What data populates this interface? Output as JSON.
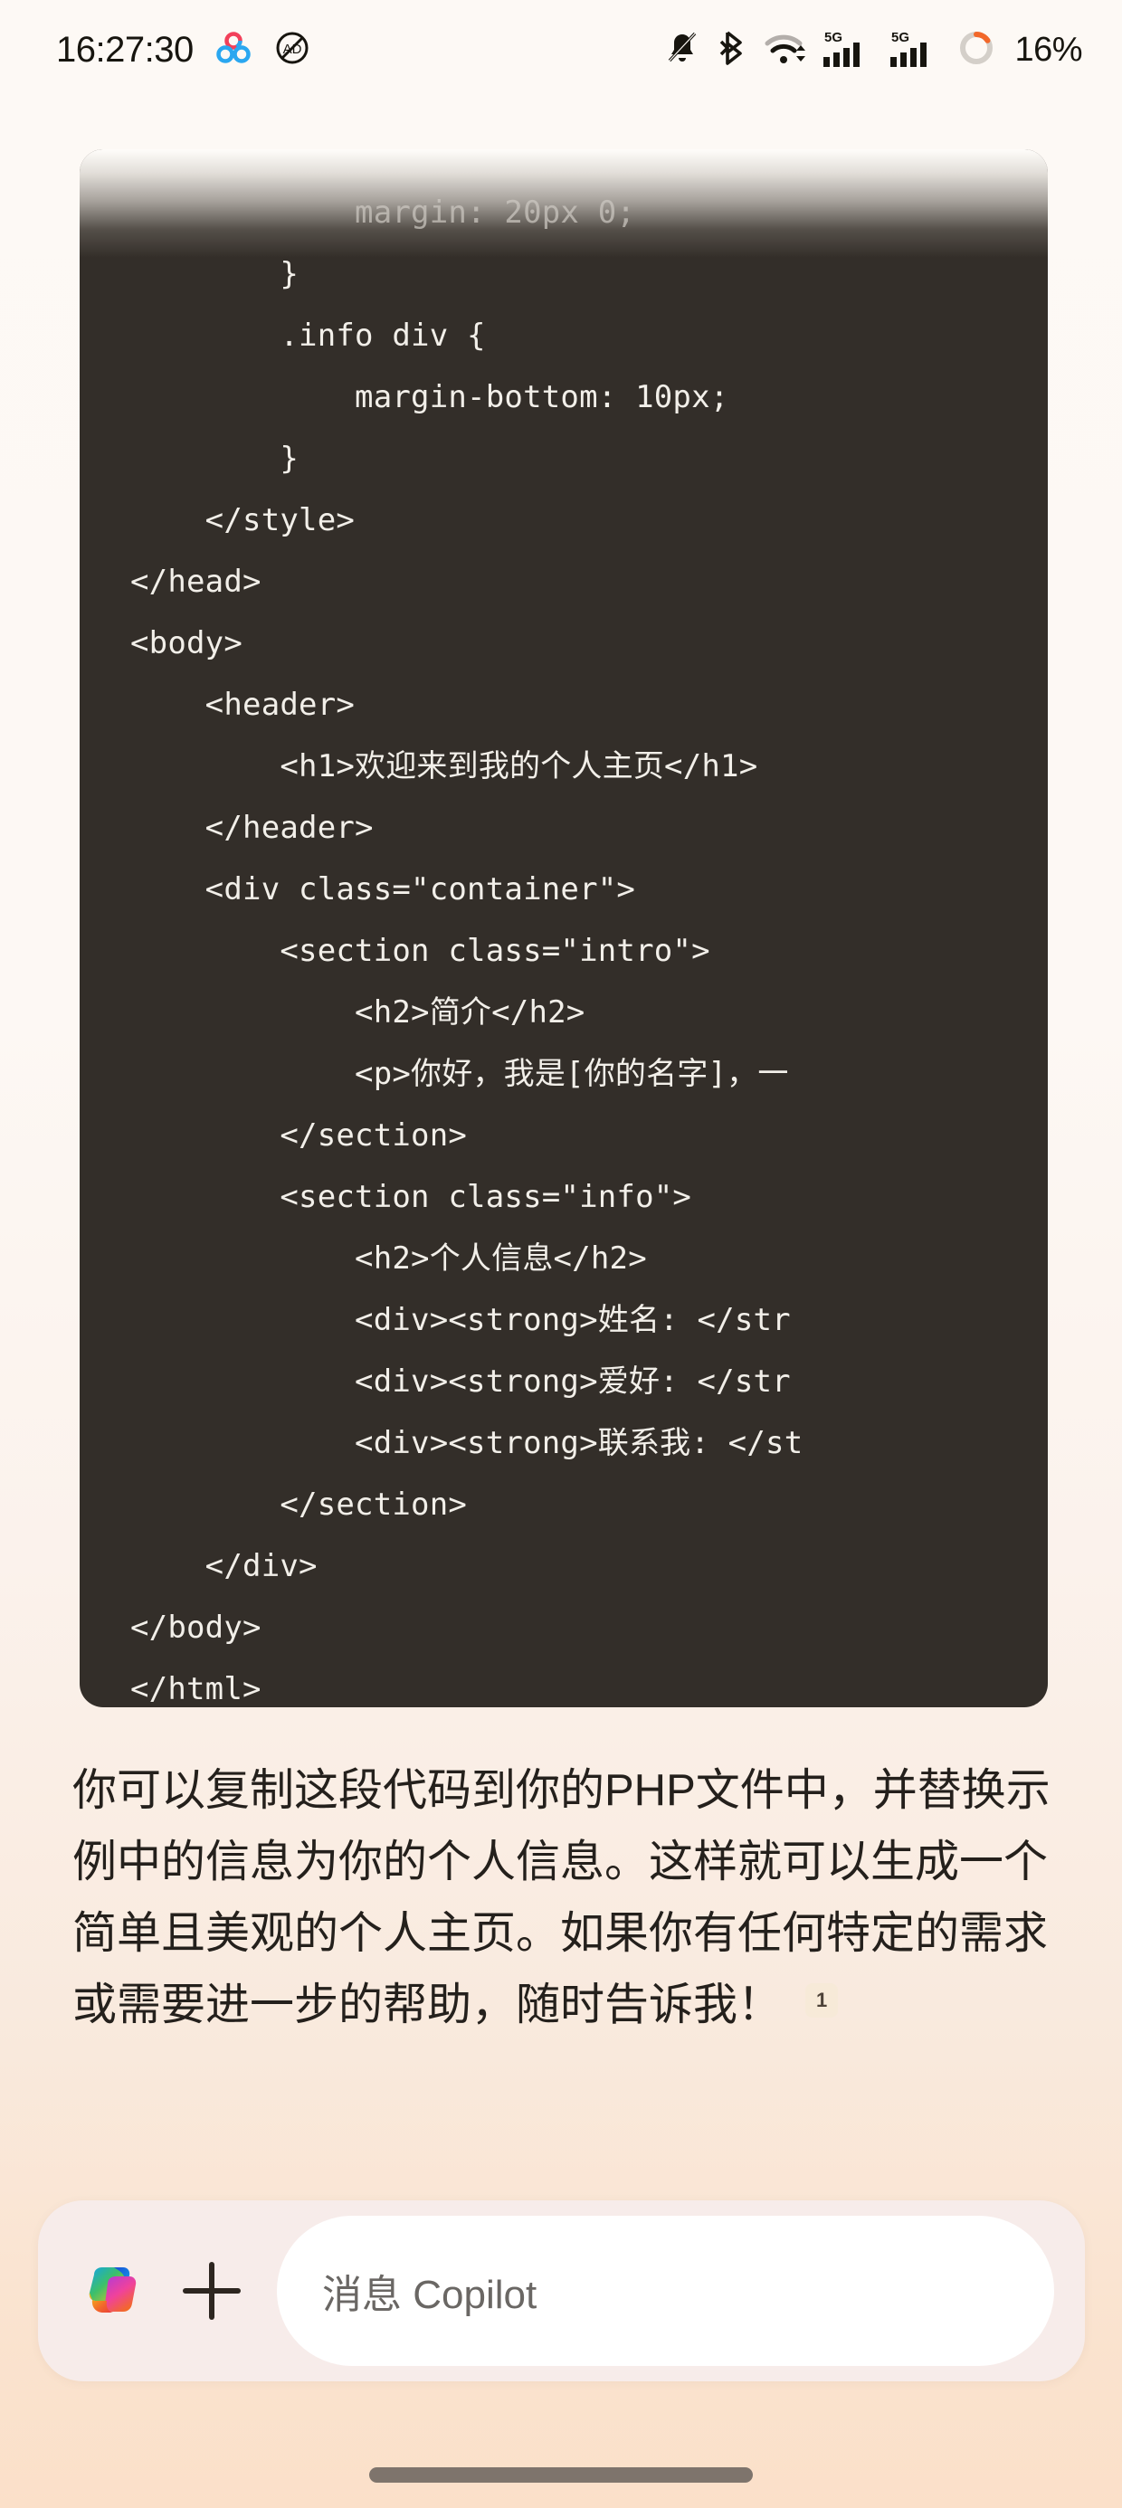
{
  "status_bar": {
    "time": "16:27:30",
    "battery_percent": "16%",
    "network_label_1": "5G",
    "network_label_2": "5G",
    "icons": [
      "tri-circle-icon",
      "ad-block-icon",
      "bell-muted-icon",
      "bluetooth-icon",
      "wifi-icon",
      "signal-5g-icon",
      "signal-5g-secondary-icon",
      "battery-ring-icon"
    ],
    "colors": {
      "text": "#17150f",
      "battery_ring_fill": "#f2682a",
      "battery_ring_track": "#d4cfc9",
      "tri_circle_blue": "#2aa7f0",
      "tri_circle_red": "#f2405a"
    }
  },
  "code_block": {
    "language_hint": "html",
    "background": "#332e29",
    "text_color": "#f2efe9",
    "has_top_scroll_fade": true,
    "lines": [
      "            margin: 20px 0;",
      "        }",
      "        .info div {",
      "            margin-bottom: 10px;",
      "        }",
      "    </style>",
      "</head>",
      "<body>",
      "    <header>",
      "        <h1>欢迎来到我的个人主页</h1>",
      "    </header>",
      "    <div class=\"container\">",
      "        <section class=\"intro\">",
      "            <h2>简介</h2>",
      "            <p>你好，我是[你的名字]，一",
      "        </section>",
      "        <section class=\"info\">",
      "            <h2>个人信息</h2>",
      "            <div><strong>姓名: </str",
      "            <div><strong>爱好: </str",
      "            <div><strong>联系我: </st",
      "        </section>",
      "    </div>",
      "</body>",
      "</html>"
    ]
  },
  "answer": {
    "paragraph": "你可以复制这段代码到你的PHP文件中，并替换示例中的信息为你的个人信息。这样就可以生成一个简单且美观的个人主页。如果你有任何特定的需求或需要进一步的帮助，随时告诉我！",
    "citation": "1"
  },
  "composer": {
    "logo_icon": "copilot-logo-icon",
    "add_icon": "plus-icon",
    "placeholder": "消息 Copilot",
    "background": "#f7ecea",
    "input_background": "#ffffff"
  },
  "system_nav": {
    "home_indicator": "home-indicator"
  }
}
